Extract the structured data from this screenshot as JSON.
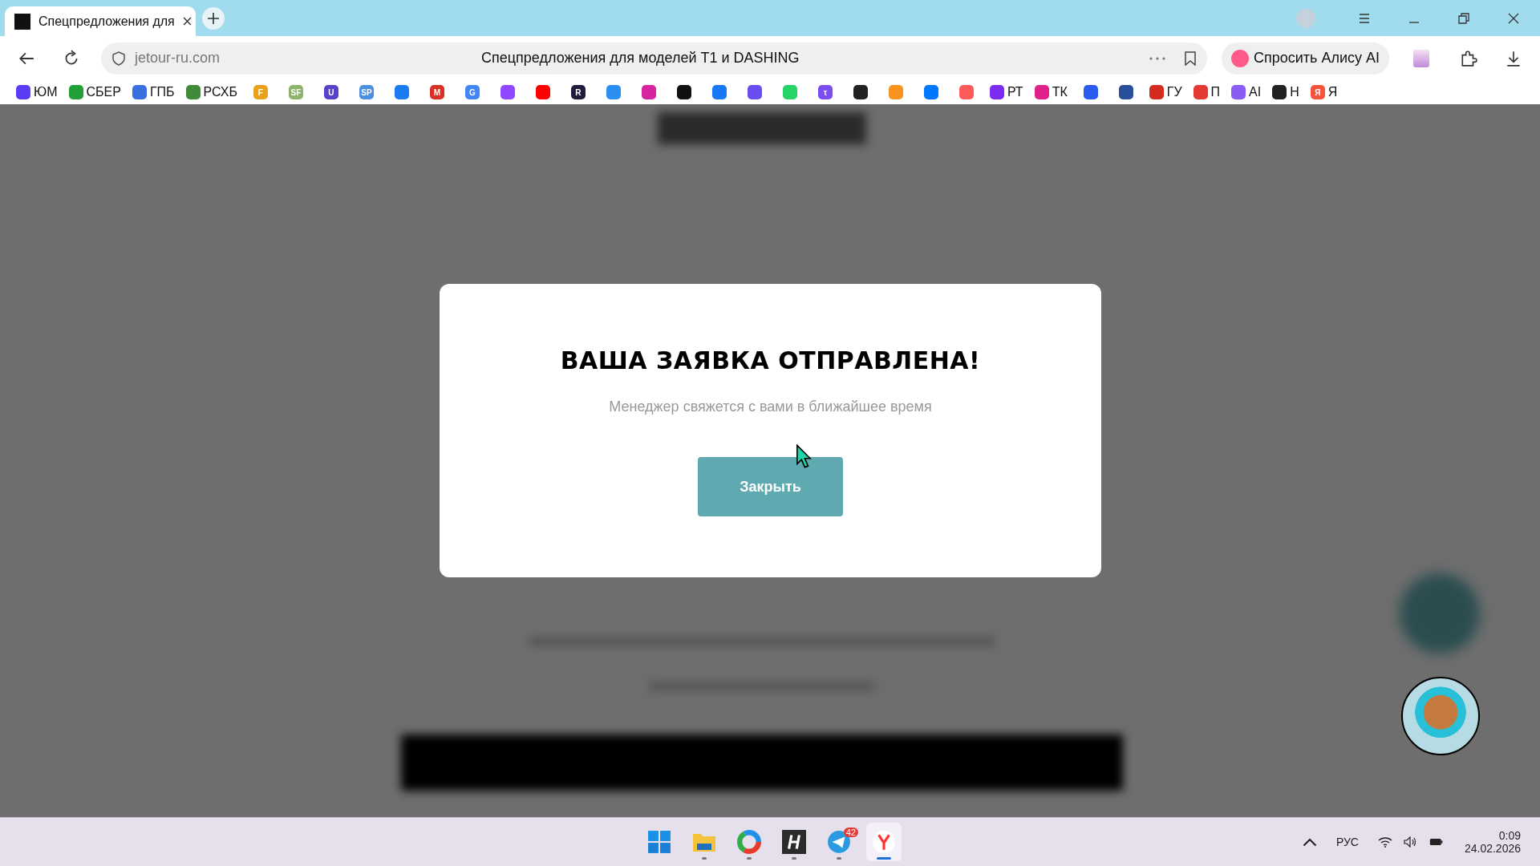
{
  "tab": {
    "title": "Спецпредложения для"
  },
  "address_bar": {
    "url": "jetour-ru.com",
    "page_title": "Спецпредложения для моделей T1 и DASHING"
  },
  "alice_button": {
    "label": "Спросить Алису AI"
  },
  "bookmarks": [
    {
      "label": "ЮМ",
      "color": "#5b3cf5"
    },
    {
      "label": "СБЕР",
      "color": "#21a038"
    },
    {
      "label": "ГПБ",
      "color": "#3a6fe0"
    },
    {
      "label": "РСХБ",
      "color": "#3f8b3a"
    },
    {
      "glyph": "F",
      "color": "#e8a21a"
    },
    {
      "glyph": "SF",
      "color": "#8db46a"
    },
    {
      "glyph": "U",
      "color": "#5840c8"
    },
    {
      "glyph": "SP",
      "color": "#4a8fe0"
    },
    {
      "color": "#1a7cf0"
    },
    {
      "glyph": "M",
      "color": "#d93025"
    },
    {
      "glyph": "G",
      "color": "#4285f4"
    },
    {
      "color": "#9146ff"
    },
    {
      "color": "#ff0000"
    },
    {
      "glyph": "R",
      "color": "#1e1e3c"
    },
    {
      "color": "#2a8ff0"
    },
    {
      "color": "#d6249f"
    },
    {
      "color": "#111111"
    },
    {
      "color": "#1877f2"
    },
    {
      "color": "#6a4cf0"
    },
    {
      "color": "#25d366"
    },
    {
      "glyph": "τ",
      "color": "#7b4df0"
    },
    {
      "color": "#222222"
    },
    {
      "color": "#f7931e"
    },
    {
      "color": "#0077ff"
    },
    {
      "color": "#ff5a5a"
    },
    {
      "label": "РТ",
      "color": "#7b2cf0"
    },
    {
      "label": "ТК",
      "color": "#e0218a"
    },
    {
      "color": "#2a5cf0"
    },
    {
      "color": "#2a4f9a"
    },
    {
      "label": "ГУ",
      "color": "#d52b1e"
    },
    {
      "label": "П",
      "color": "#e53935"
    },
    {
      "label": "AI",
      "color": "#8a5cf6"
    },
    {
      "label": "Н",
      "color": "#222222"
    },
    {
      "glyph": "Я",
      "label": "Я",
      "color": "#f4533c"
    }
  ],
  "modal": {
    "title": "ВАША ЗАЯВКА ОТПРАВЛЕНА!",
    "message": "Менеджер свяжется с вами в ближайшее время",
    "button": "Закрыть"
  },
  "taskbar": {
    "apps": [
      {
        "kind": "start",
        "selected": false,
        "running": false
      },
      {
        "kind": "folder",
        "selected": false,
        "running": true
      },
      {
        "kind": "browser",
        "selected": false,
        "running": true
      },
      {
        "kind": "h-app",
        "selected": false,
        "running": true
      },
      {
        "kind": "telegram",
        "selected": false,
        "running": true,
        "badge": "42"
      },
      {
        "kind": "yandex",
        "selected": true,
        "running": true
      }
    ],
    "language": "РУС",
    "time": "0:09",
    "date": "24.02.2026"
  }
}
